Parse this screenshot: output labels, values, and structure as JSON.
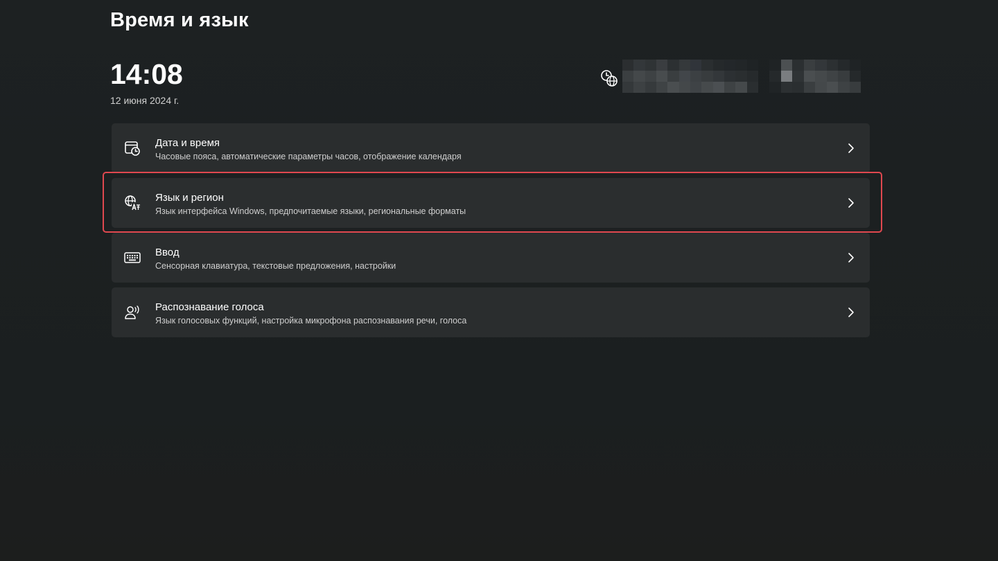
{
  "header": {
    "title": "Время и язык"
  },
  "clock": {
    "time": "14:08",
    "date": "12 июня 2024 г."
  },
  "timezone": {
    "icon": "clock-globe-icon"
  },
  "items": [
    {
      "title": "Дата и время",
      "description": "Часовые пояса, автоматические параметры часов, отображение календаря",
      "icon": "calendar-clock-icon"
    },
    {
      "title": "Язык и регион",
      "description": "Язык интерфейса Windows, предпочитаемые языки, региональные форматы",
      "icon": "language-globe-icon",
      "highlighted": true
    },
    {
      "title": "Ввод",
      "description": "Сенсорная клавиатура, текстовые предложения, настройки",
      "icon": "keyboard-icon"
    },
    {
      "title": "Распознавание голоса",
      "description": "Язык голосовых функций, настройка микрофона распознавания речи, голоса",
      "icon": "voice-person-icon"
    }
  ],
  "colors": {
    "background": "#1c2021",
    "card": "#2a2d2e",
    "highlight": "#e0484f",
    "text_primary": "#ffffff",
    "text_secondary": "#cfcfcf"
  }
}
